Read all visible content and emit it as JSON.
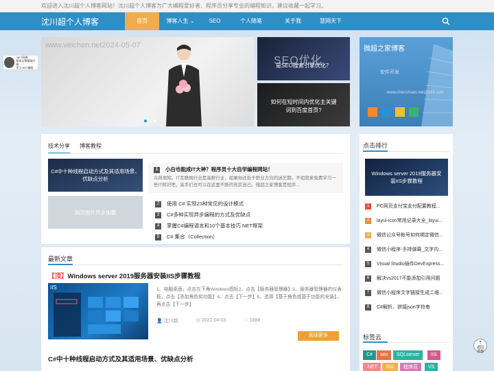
{
  "topbar": {
    "text": "欢迎进入沈川超个人博客网站！沈川超个人博客为广大编程爱好者、程序员分享专业的编程知识，建议收藏一起学习。"
  },
  "nav": {
    "logo": "沈川超个人博客",
    "items": [
      {
        "label": "首页",
        "active": true
      },
      {
        "label": "博客人生 ⌄",
        "active": false
      },
      {
        "label": "SEO",
        "active": false
      },
      {
        "label": "个人随笔",
        "active": false
      },
      {
        "label": "关于我",
        "active": false
      },
      {
        "label": "慧网天下",
        "active": false
      }
    ]
  },
  "ad": {
    "title": ".NET经典",
    "line1": "帮你从零基础开始",
    "line2": "学习.NET编程"
  },
  "hero": {
    "watermark": "www.veichen.net2024-05-07"
  },
  "tiles": {
    "seo": {
      "big": "SEO优化",
      "caption": "是SEO搜索引擎优化？"
    },
    "keyword": {
      "caption1": "如何在短时间内优化主关键",
      "caption2": "词到百度首页?"
    }
  },
  "side_banner": {
    "title": "微超之家博客",
    "sub": "软件开发",
    "sub2": "www.chenchuan.net@163.com"
  },
  "tech": {
    "tabs": [
      "技术分享",
      "博客教程"
    ],
    "thumb1": "C#中十种线程启动方式及其适用场景、优缺点分析",
    "thumb2": "网页图片异步加载",
    "hot_title": "小白也能成IT大神？程序员十大自学编程网站！",
    "hot_desc": "众所周知，IT互联网行业是高薪行业，如果你还处于职业方向的迷茫期，不如就来免费学习一些IT知识吧，高手们也可以在这里不断的充实自己。微超之家博客是程序...",
    "items": [
      {
        "num": "2",
        "label": "使用 C# 实现23种常见的设计模式"
      },
      {
        "num": "3",
        "label": "C#多种实现异步编程的方式及优缺点"
      },
      {
        "num": "4",
        "label": "掌握C#编程语言和10个基本技巧.NET框架"
      },
      {
        "num": "5",
        "label": "C# 集合（Collection）"
      }
    ]
  },
  "latest": {
    "title": "最新文章",
    "article1": {
      "tag": "【顶】",
      "title": "Windows server 2019服务器安装IIS步骤教程",
      "desc": "1、电脑桌面，点击左下角Windows图标2、点击【服务器管理器】3、服务器管理器的仪表板，点击【添加角色和功能】4、点击【下一步】5、选择【基于角色或基于功能的安装】，再点击【下一步】",
      "author": "沈川超",
      "date": "2022-04-03",
      "views": "1888",
      "read_more": "阅读更多",
      "img_label": "IIS"
    },
    "article2": {
      "title": "C#中十种线程启动方式及其适用场景、优缺点分析"
    }
  },
  "rank": {
    "title": "点击排行",
    "img_caption": "Windows server 2019服务器安装IIS步骤教程",
    "items": [
      {
        "num": "1",
        "label": "PC网页支付宝支付配置教程..."
      },
      {
        "num": "2",
        "label": "layui-icon常用记录大全_layui..."
      },
      {
        "num": "3",
        "label": "微信公众号帐号如何绑定微信..."
      },
      {
        "num": "4",
        "label": "微信小程序-手持弹幕_文字内..."
      },
      {
        "num": "5",
        "label": "Visual Studio插件DevExpress..."
      },
      {
        "num": "6",
        "label": "解决vs2017不能添加引用问题"
      },
      {
        "num": "7",
        "label": "微信小程序文字链接生成二维..."
      },
      {
        "num": "8",
        "label": "C#解析、拼接json字符串"
      }
    ]
  },
  "tags": {
    "title": "标签云",
    "items": [
      {
        "label": "C#",
        "color": "#1e9a8a"
      },
      {
        "label": "seo",
        "color": "#e8734a"
      },
      {
        "label": "SQLserver",
        "color": "#2bb3a2"
      },
      {
        "label": "IIS",
        "color": "#d65a8c"
      },
      {
        "label": ".NET",
        "color": "#f08a8a"
      },
      {
        "label": "SSL",
        "color": "#f0b050"
      },
      {
        "label": "程序员",
        "color": "#d67bb0"
      },
      {
        "label": "VS",
        "color": "#2bb3a2"
      }
    ]
  },
  "backtop": {
    "line1": "返回",
    "line2": "顶部"
  }
}
